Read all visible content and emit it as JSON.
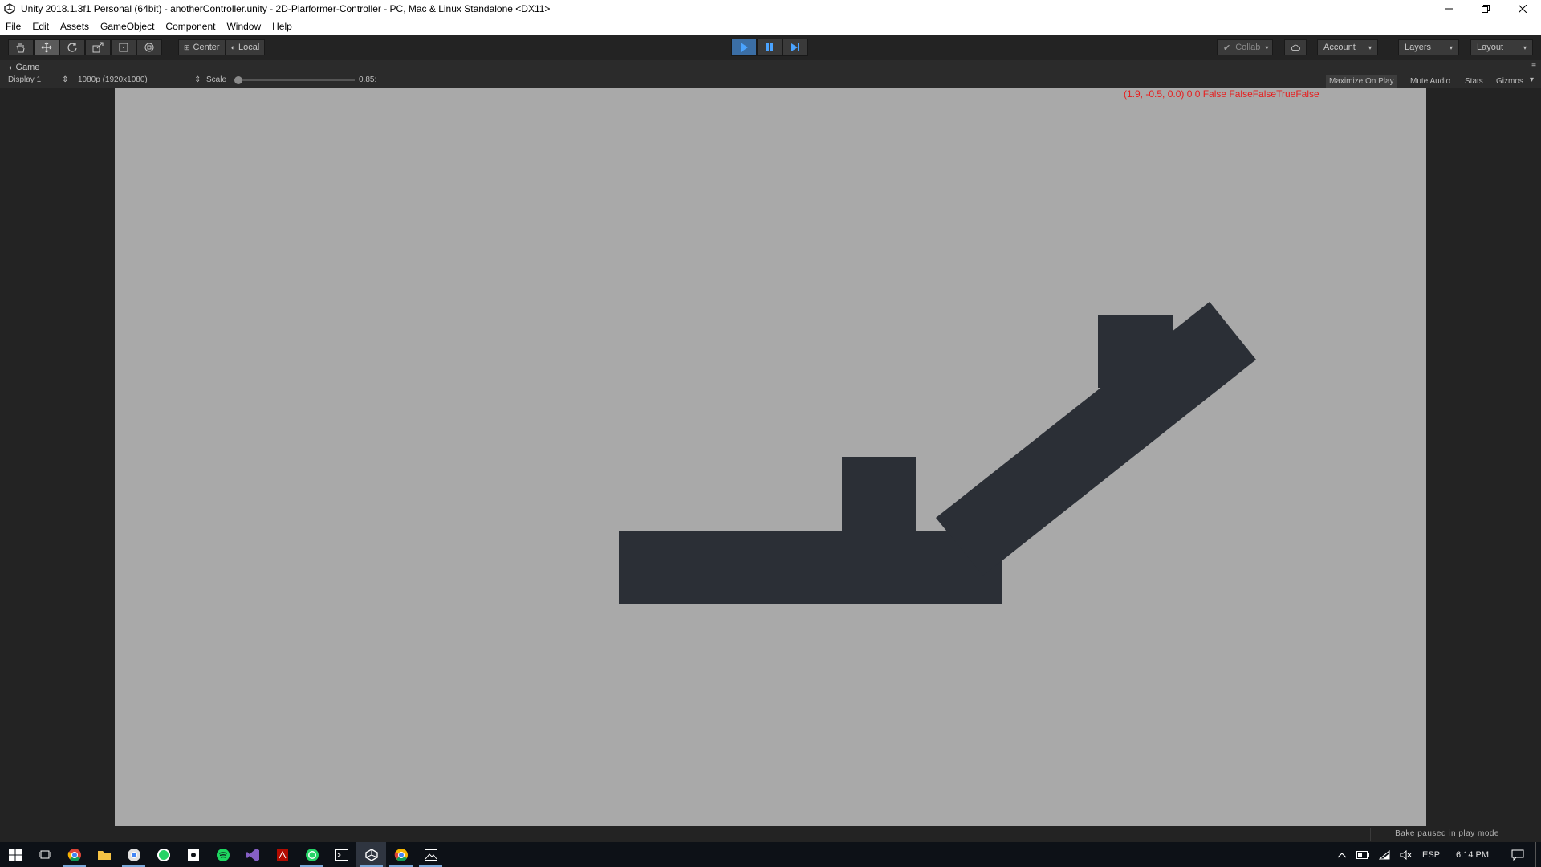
{
  "window": {
    "title": "Unity 2018.1.3f1 Personal (64bit) - anotherController.unity - 2D-Plarformer-Controller - PC, Mac & Linux Standalone <DX11>",
    "controls": [
      "minimize",
      "restore",
      "close"
    ]
  },
  "menu": {
    "items": [
      "File",
      "Edit",
      "Assets",
      "GameObject",
      "Component",
      "Window",
      "Help"
    ]
  },
  "toolbar": {
    "tools": [
      "hand-icon",
      "move-icon",
      "rotate-icon",
      "scale-icon",
      "rect-icon",
      "transform-icon"
    ],
    "active_tool": "move-icon",
    "pivot_label": "Center",
    "rotation_label": "Local",
    "play_state": "playing",
    "collab_label": "Collab",
    "account_label": "Account",
    "layers_label": "Layers",
    "layout_label": "Layout"
  },
  "game_view": {
    "tab_label": "Game",
    "display_label": "Display 1",
    "resolution_label": "1080p (1920x1080)",
    "scale_label": "Scale",
    "scale_value": "0.85:",
    "maximize_label": "Maximize On Play",
    "mute_label": "Mute Audio",
    "stats_label": "Stats",
    "gizmos_label": "Gizmos",
    "debug_text": "(1.9, -0.5, 0.0) 0 0 False FalseFalseTrueFalse",
    "background_color": "#a9a9a9",
    "shape_color": "#2b2f36"
  },
  "status": {
    "message": "Bake paused in play mode"
  },
  "taskbar": {
    "icons": [
      "windows-start-icon",
      "task-view-icon",
      "chrome-icon",
      "file-explorer-icon",
      "chrome-alt-icon",
      "whatsapp-icon",
      "app-icon",
      "spotify-icon",
      "visual-studio-icon",
      "acrobat-icon",
      "whatsapp-alt-icon",
      "terminal-icon",
      "unity-icon",
      "chrome-canary-icon",
      "photos-icon"
    ],
    "language": "ESP",
    "time": "6:14 PM"
  }
}
